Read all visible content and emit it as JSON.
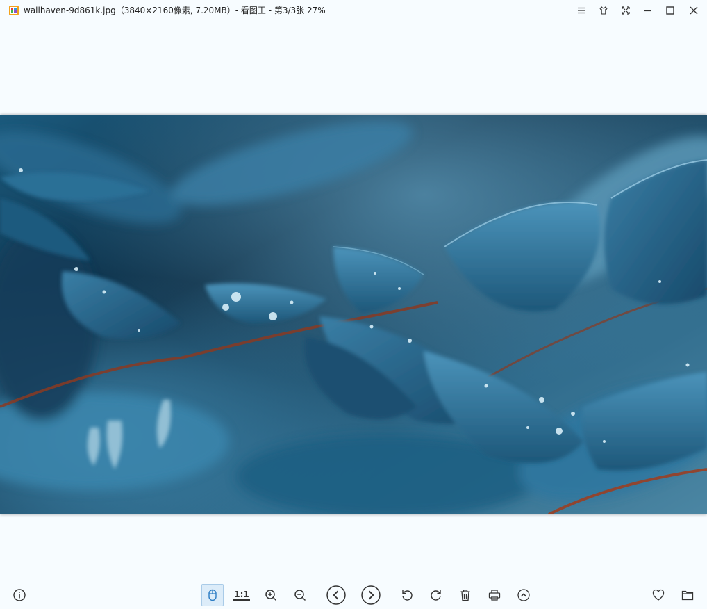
{
  "window": {
    "title": "wallhaven-9d861k.jpg（3840×2160像素, 7.20MB）- 看图王 - 第3/3张 27%",
    "controls": [
      "menu-icon",
      "skin-icon",
      "fullscreen-icon",
      "minimize-icon",
      "maximize-icon",
      "close-icon"
    ]
  },
  "image": {
    "description_colors": {
      "dark": "#0b2436",
      "mid": "#2b6d92",
      "light": "#6fb0cf",
      "stem": "#8a3a22"
    }
  },
  "toolbar": {
    "actual_size_label": "1:1",
    "buttons": [
      "info-icon",
      "mouse-mode-icon",
      "actual-size",
      "zoom-in-icon",
      "zoom-out-icon",
      "previous-icon",
      "next-icon",
      "rotate-left-icon",
      "rotate-right-icon",
      "delete-icon",
      "print-icon",
      "more-icon",
      "favorite-icon",
      "open-folder-icon"
    ]
  },
  "colors": {
    "background": "#f7fcff",
    "icon": "#333333",
    "active_bg": "#dcecf9"
  }
}
